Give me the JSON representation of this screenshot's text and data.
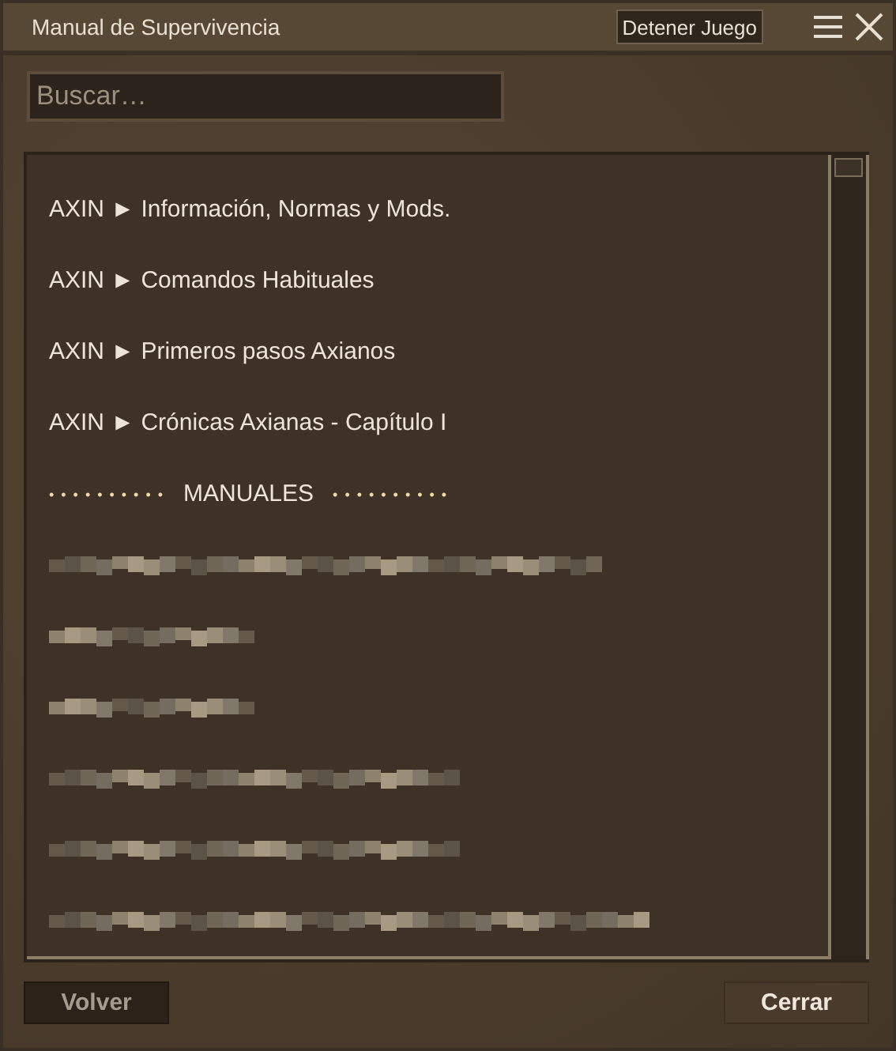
{
  "window": {
    "title": "Manual de Supervivencia",
    "action_button": "Detener Juego"
  },
  "search": {
    "placeholder": "Buscar…"
  },
  "items": [
    {
      "kind": "link",
      "prefix": "AXIN",
      "arrow": "►",
      "label": "Información, Normas y Mods."
    },
    {
      "kind": "link",
      "prefix": "AXIN",
      "arrow": "►",
      "label": "Comandos Habituales"
    },
    {
      "kind": "link",
      "prefix": "AXIN",
      "arrow": "►",
      "label": "Primeros pasos Axianos"
    },
    {
      "kind": "link",
      "prefix": "AXIN",
      "arrow": "►",
      "label": "Crónicas Axianas - Capítulo I"
    },
    {
      "kind": "section",
      "left": "• • • • • • • • • •",
      "label": "MANUALES",
      "right": "• • • • • • • • • •"
    },
    {
      "kind": "blurlong"
    },
    {
      "kind": "blurshort"
    },
    {
      "kind": "blurshort"
    },
    {
      "kind": "blurmedium"
    },
    {
      "kind": "blurmedium"
    },
    {
      "kind": "blurextra"
    }
  ],
  "buttons": [
    {
      "label": "Volver",
      "disabled": true
    },
    {
      "label": "Cerrar",
      "disabled": false
    }
  ]
}
